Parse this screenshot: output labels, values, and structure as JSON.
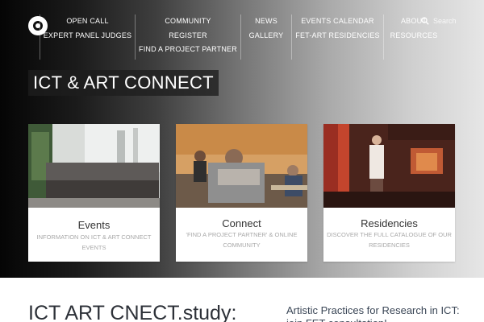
{
  "header": {
    "nav_columns": [
      [
        "OPEN CALL",
        "EXPERT PANEL JUDGES"
      ],
      [
        "COMMUNITY",
        "REGISTER",
        "FIND A PROJECT PARTNER"
      ],
      [
        "NEWS",
        "GALLERY"
      ],
      [
        "EVENTS CALENDAR",
        "FET-ART RESIDENCIES"
      ],
      [
        "ABOUT",
        "RESOURCES"
      ]
    ],
    "search_placeholder": "Search"
  },
  "hero": {
    "site_title": "ICT & ART CONNECT"
  },
  "cards": [
    {
      "title": "Events",
      "subtitle": "INFORMATION ON ICT & ART CONNECT EVENTS",
      "image": "group-photo"
    },
    {
      "title": "Connect",
      "subtitle": "'FIND A PROJECT PARTNER' & ONLINE COMMUNITY",
      "image": "people-embracing"
    },
    {
      "title": "Residencies",
      "subtitle": "DISCOVER THE FULL CATALOGUE OF OUR RESIDENCIES",
      "image": "lab-interior"
    }
  ],
  "latest": {
    "title": "ICT ART CNECT.study:",
    "side_title": "Artistic Practices for Research in ICT: join FET consultation!"
  },
  "colors": {
    "card_title": "#333333",
    "card_subtitle": "#a9a9a9",
    "heading": "#2d3138",
    "side_heading": "#3a4656"
  }
}
